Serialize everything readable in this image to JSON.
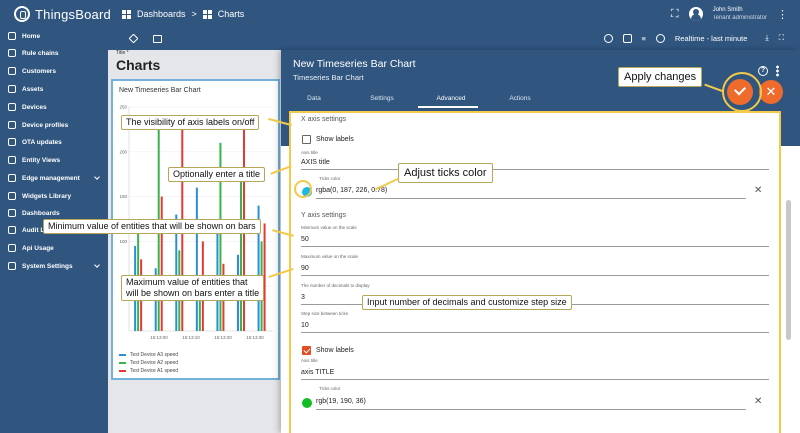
{
  "app": {
    "logo_text": "ThingsBoard",
    "breadcrumb": {
      "dashboards": "Dashboards",
      "separator": ">",
      "charts": "Charts"
    },
    "user": {
      "name": "John Smith",
      "role": "Tenant administrator"
    }
  },
  "sidebar": {
    "items": [
      {
        "label": "Home",
        "icon": "home-icon"
      },
      {
        "label": "Rule chains",
        "icon": "rule-chain-icon"
      },
      {
        "label": "Customers",
        "icon": "customers-icon"
      },
      {
        "label": "Assets",
        "icon": "assets-icon"
      },
      {
        "label": "Devices",
        "icon": "devices-icon"
      },
      {
        "label": "Device profiles",
        "icon": "device-profile-icon"
      },
      {
        "label": "OTA updates",
        "icon": "ota-icon"
      },
      {
        "label": "Entity Views",
        "icon": "entity-view-icon"
      },
      {
        "label": "Edge management",
        "icon": "edge-icon"
      },
      {
        "label": "Widgets Library",
        "icon": "widgets-icon"
      },
      {
        "label": "Dashboards",
        "icon": "dashboards-icon"
      },
      {
        "label": "Audit Lo",
        "icon": "audit-icon"
      },
      {
        "label": "Api Usage",
        "icon": "api-usage-icon"
      },
      {
        "label": "System Settings",
        "icon": "settings-icon"
      }
    ]
  },
  "toolbar": {
    "timewindow": "Realtime - last minute"
  },
  "dashboard": {
    "title_label": "Title *",
    "title": "Charts",
    "widget_title": "New Timeseries Bar Chart",
    "legend": [
      {
        "name": "Test Device A3 speed",
        "color": "#2b8fd6"
      },
      {
        "name": "Test Device A2 speed",
        "color": "#3bb34a"
      },
      {
        "name": "Test Device A1 speed",
        "color": "#e53935"
      }
    ]
  },
  "chart_data": {
    "type": "bar",
    "y_ticks": [
      "250",
      "200",
      "150",
      "100",
      "50"
    ],
    "x_ticks": [
      "15:13:00",
      "15:13:10",
      "15:13:20",
      "15:13:30"
    ],
    "ylim": [
      0,
      250
    ],
    "series": [
      {
        "name": "Test Device A3 speed",
        "color": "#2b8fd6",
        "values": [
          95,
          70,
          130,
          160,
          110,
          85,
          140
        ]
      },
      {
        "name": "Test Device A2 speed",
        "color": "#3bb34a",
        "values": [
          120,
          230,
          90,
          60,
          210,
          180,
          100
        ]
      },
      {
        "name": "Test Device A1 speed",
        "color": "#e53935",
        "values": [
          80,
          150,
          240,
          100,
          75,
          230,
          120
        ]
      }
    ]
  },
  "panel": {
    "title": "New Timeseries Bar Chart",
    "subtitle": "Timeseries Bar Chart",
    "tabs": [
      "Data",
      "Settings",
      "Advanced",
      "Actions"
    ],
    "active_tab": "Advanced",
    "x_axis": {
      "section": "X axis settings",
      "show_labels": "Show labels",
      "axis_title_label": "Axis title",
      "axis_title_value": "AXIS title",
      "ticks_color_label": "Ticks color",
      "ticks_color_value": "rgba(0, 187, 226, 0.78)",
      "ticks_color": "#00bbe2"
    },
    "y_axis": {
      "section": "Y axis settings",
      "min_label": "Minimum value on the scale",
      "min_value": "50",
      "max_label": "Maximum value on the scale",
      "max_value": "90",
      "decimals_label": "The number of decimals to display",
      "decimals_value": "3",
      "step_label": "Step size between ticks",
      "step_value": "10",
      "show_labels": "Show labels",
      "axis_title_label": "Axis title",
      "axis_title_value": "axis TITLE",
      "ticks_color_label": "Ticks color",
      "ticks_color_value": "rgb(19, 190, 36)",
      "ticks_color": "#13be24"
    }
  },
  "annotations": {
    "apply": "Apply changes",
    "visibility": "The visibility of axis labels on/off",
    "title": "Optionally enter a title",
    "ticks": "Adjust ticks color",
    "min": "Minimum value of entities that will be shown on bars",
    "max_line1": "Maximum value of entities that",
    "max_line2": "will be shown on bars enter a title",
    "decimals": "Input number of decimals and customize step size"
  }
}
